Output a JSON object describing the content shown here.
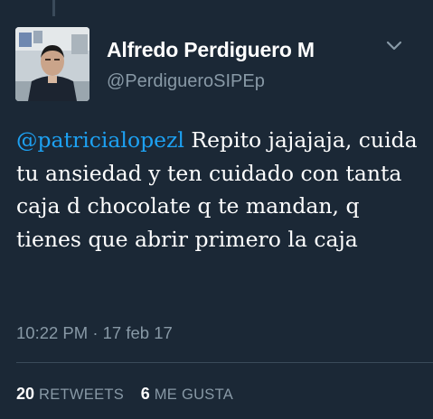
{
  "author": {
    "name": "Alfredo Perdiguero M",
    "handle": "@PerdigueroSIPEp"
  },
  "tweet": {
    "mention": "@patricialopezl",
    "text": " Repito jajajaja, cuida tu ansiedad y ten cuidado con tanta caja d chocolate q te mandan, q tienes que abrir primero la caja",
    "timestamp": "10:22 PM · 17 feb 17"
  },
  "stats": {
    "retweets_count": "20",
    "retweets_label": "RETWEETS",
    "likes_count": "6",
    "likes_label": "ME GUSTA"
  },
  "icons": {
    "menu": "chevron-down-icon"
  },
  "colors": {
    "background": "#1b2836",
    "mention": "#1da1f2",
    "secondary_text": "#8899a6",
    "divider": "#3a4a5a"
  }
}
